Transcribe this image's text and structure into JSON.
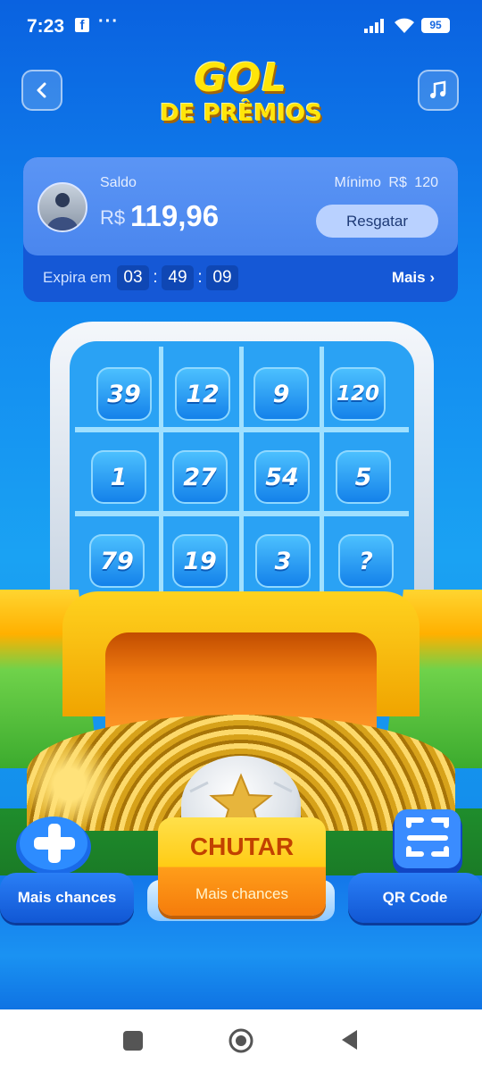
{
  "status_bar": {
    "time": "7:23",
    "facebook_glyph": "f",
    "dots": "···",
    "battery": "95"
  },
  "header": {
    "title_line1": "GOL",
    "title_line2": "DE PRÊMIOS",
    "back_icon": "chevron-left-icon",
    "music_icon": "music-note-icon"
  },
  "balance": {
    "saldo_label": "Saldo",
    "currency": "R$",
    "amount": "119,96",
    "minimum_label": "Mínimo  R$ 120",
    "redeem_button": "Resgatar",
    "expires_label": "Expira em",
    "timer": {
      "hours": "03",
      "minutes": "49",
      "seconds": "09",
      "sep": ":"
    },
    "more_label": "Mais ›"
  },
  "board": {
    "rows": [
      [
        "39",
        "12",
        "9",
        "120"
      ],
      [
        "1",
        "27",
        "54",
        "5"
      ],
      [
        "79",
        "19",
        "3",
        "?"
      ]
    ]
  },
  "actions": {
    "more_chances_label": "Mais chances",
    "kick_label": "CHUTAR",
    "kick_sub": "Mais chances",
    "qr_label": "QR Code"
  },
  "colors": {
    "title_yellow": "#ffe50a",
    "kick_orange": "#f57c0b",
    "card_blue": "#4a86ee"
  }
}
